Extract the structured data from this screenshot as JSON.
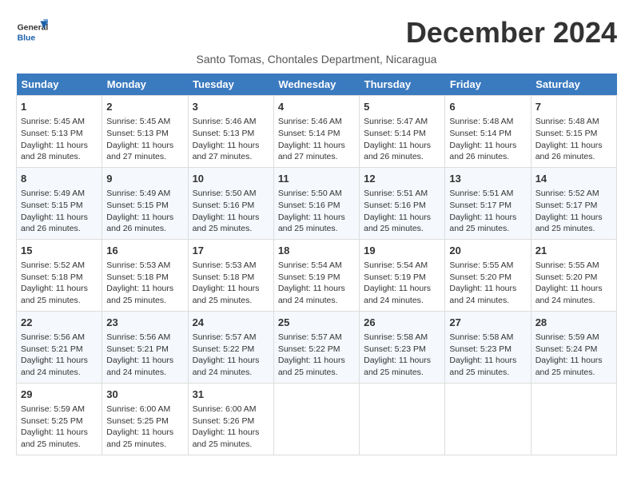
{
  "header": {
    "logo_general": "General",
    "logo_blue": "Blue",
    "month_title": "December 2024",
    "subtitle": "Santo Tomas, Chontales Department, Nicaragua"
  },
  "weekdays": [
    "Sunday",
    "Monday",
    "Tuesday",
    "Wednesday",
    "Thursday",
    "Friday",
    "Saturday"
  ],
  "weeks": [
    [
      {
        "day": "1",
        "info": "Sunrise: 5:45 AM\nSunset: 5:13 PM\nDaylight: 11 hours\nand 28 minutes."
      },
      {
        "day": "2",
        "info": "Sunrise: 5:45 AM\nSunset: 5:13 PM\nDaylight: 11 hours\nand 27 minutes."
      },
      {
        "day": "3",
        "info": "Sunrise: 5:46 AM\nSunset: 5:13 PM\nDaylight: 11 hours\nand 27 minutes."
      },
      {
        "day": "4",
        "info": "Sunrise: 5:46 AM\nSunset: 5:14 PM\nDaylight: 11 hours\nand 27 minutes."
      },
      {
        "day": "5",
        "info": "Sunrise: 5:47 AM\nSunset: 5:14 PM\nDaylight: 11 hours\nand 26 minutes."
      },
      {
        "day": "6",
        "info": "Sunrise: 5:48 AM\nSunset: 5:14 PM\nDaylight: 11 hours\nand 26 minutes."
      },
      {
        "day": "7",
        "info": "Sunrise: 5:48 AM\nSunset: 5:15 PM\nDaylight: 11 hours\nand 26 minutes."
      }
    ],
    [
      {
        "day": "8",
        "info": "Sunrise: 5:49 AM\nSunset: 5:15 PM\nDaylight: 11 hours\nand 26 minutes."
      },
      {
        "day": "9",
        "info": "Sunrise: 5:49 AM\nSunset: 5:15 PM\nDaylight: 11 hours\nand 26 minutes."
      },
      {
        "day": "10",
        "info": "Sunrise: 5:50 AM\nSunset: 5:16 PM\nDaylight: 11 hours\nand 25 minutes."
      },
      {
        "day": "11",
        "info": "Sunrise: 5:50 AM\nSunset: 5:16 PM\nDaylight: 11 hours\nand 25 minutes."
      },
      {
        "day": "12",
        "info": "Sunrise: 5:51 AM\nSunset: 5:16 PM\nDaylight: 11 hours\nand 25 minutes."
      },
      {
        "day": "13",
        "info": "Sunrise: 5:51 AM\nSunset: 5:17 PM\nDaylight: 11 hours\nand 25 minutes."
      },
      {
        "day": "14",
        "info": "Sunrise: 5:52 AM\nSunset: 5:17 PM\nDaylight: 11 hours\nand 25 minutes."
      }
    ],
    [
      {
        "day": "15",
        "info": "Sunrise: 5:52 AM\nSunset: 5:18 PM\nDaylight: 11 hours\nand 25 minutes."
      },
      {
        "day": "16",
        "info": "Sunrise: 5:53 AM\nSunset: 5:18 PM\nDaylight: 11 hours\nand 25 minutes."
      },
      {
        "day": "17",
        "info": "Sunrise: 5:53 AM\nSunset: 5:18 PM\nDaylight: 11 hours\nand 25 minutes."
      },
      {
        "day": "18",
        "info": "Sunrise: 5:54 AM\nSunset: 5:19 PM\nDaylight: 11 hours\nand 24 minutes."
      },
      {
        "day": "19",
        "info": "Sunrise: 5:54 AM\nSunset: 5:19 PM\nDaylight: 11 hours\nand 24 minutes."
      },
      {
        "day": "20",
        "info": "Sunrise: 5:55 AM\nSunset: 5:20 PM\nDaylight: 11 hours\nand 24 minutes."
      },
      {
        "day": "21",
        "info": "Sunrise: 5:55 AM\nSunset: 5:20 PM\nDaylight: 11 hours\nand 24 minutes."
      }
    ],
    [
      {
        "day": "22",
        "info": "Sunrise: 5:56 AM\nSunset: 5:21 PM\nDaylight: 11 hours\nand 24 minutes."
      },
      {
        "day": "23",
        "info": "Sunrise: 5:56 AM\nSunset: 5:21 PM\nDaylight: 11 hours\nand 24 minutes."
      },
      {
        "day": "24",
        "info": "Sunrise: 5:57 AM\nSunset: 5:22 PM\nDaylight: 11 hours\nand 24 minutes."
      },
      {
        "day": "25",
        "info": "Sunrise: 5:57 AM\nSunset: 5:22 PM\nDaylight: 11 hours\nand 25 minutes."
      },
      {
        "day": "26",
        "info": "Sunrise: 5:58 AM\nSunset: 5:23 PM\nDaylight: 11 hours\nand 25 minutes."
      },
      {
        "day": "27",
        "info": "Sunrise: 5:58 AM\nSunset: 5:23 PM\nDaylight: 11 hours\nand 25 minutes."
      },
      {
        "day": "28",
        "info": "Sunrise: 5:59 AM\nSunset: 5:24 PM\nDaylight: 11 hours\nand 25 minutes."
      }
    ],
    [
      {
        "day": "29",
        "info": "Sunrise: 5:59 AM\nSunset: 5:25 PM\nDaylight: 11 hours\nand 25 minutes."
      },
      {
        "day": "30",
        "info": "Sunrise: 6:00 AM\nSunset: 5:25 PM\nDaylight: 11 hours\nand 25 minutes."
      },
      {
        "day": "31",
        "info": "Sunrise: 6:00 AM\nSunset: 5:26 PM\nDaylight: 11 hours\nand 25 minutes."
      },
      null,
      null,
      null,
      null
    ]
  ]
}
